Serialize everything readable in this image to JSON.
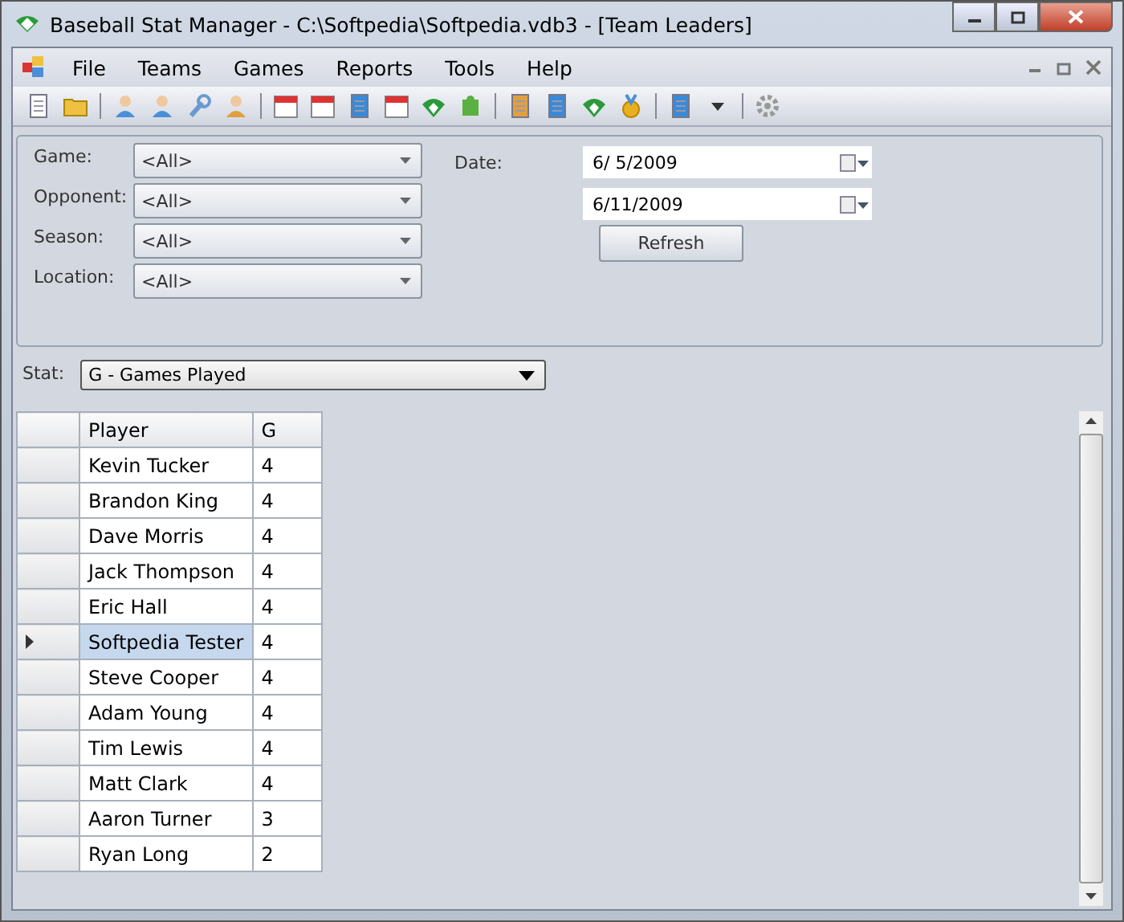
{
  "window": {
    "title": "Baseball Stat Manager - C:\\Softpedia\\Softpedia.vdb3 - [Team Leaders]"
  },
  "menu": [
    "File",
    "Teams",
    "Games",
    "Reports",
    "Tools",
    "Help"
  ],
  "filters": [
    {
      "label": "Game:",
      "value": "<All>"
    },
    {
      "label": "Opponent:",
      "value": "<All>"
    },
    {
      "label": "Season:",
      "value": "<All>"
    },
    {
      "label": "Location:",
      "value": "<All>"
    }
  ],
  "date": {
    "label": "Date:",
    "from": "6/  5/2009",
    "to": "6/11/2009"
  },
  "refresh_button": "Refresh",
  "stat": {
    "label": "Stat:",
    "value": "G - Games Played"
  },
  "table": {
    "columns": [
      "Player",
      "G"
    ],
    "rows": [
      {
        "player": "Kevin Tucker",
        "g": "4",
        "selected": false
      },
      {
        "player": "Brandon King",
        "g": "4",
        "selected": false
      },
      {
        "player": "Dave Morris",
        "g": "4",
        "selected": false
      },
      {
        "player": "Jack Thompson",
        "g": "4",
        "selected": false
      },
      {
        "player": "Eric Hall",
        "g": "4",
        "selected": false
      },
      {
        "player": "Softpedia Tester",
        "g": "4",
        "selected": true
      },
      {
        "player": "Steve Cooper",
        "g": "4",
        "selected": false
      },
      {
        "player": "Adam Young",
        "g": "4",
        "selected": false
      },
      {
        "player": "Tim Lewis",
        "g": "4",
        "selected": false
      },
      {
        "player": "Matt Clark",
        "g": "4",
        "selected": false
      },
      {
        "player": "Aaron Turner",
        "g": "3",
        "selected": false
      },
      {
        "player": "Ryan Long",
        "g": "2",
        "selected": false
      }
    ]
  }
}
